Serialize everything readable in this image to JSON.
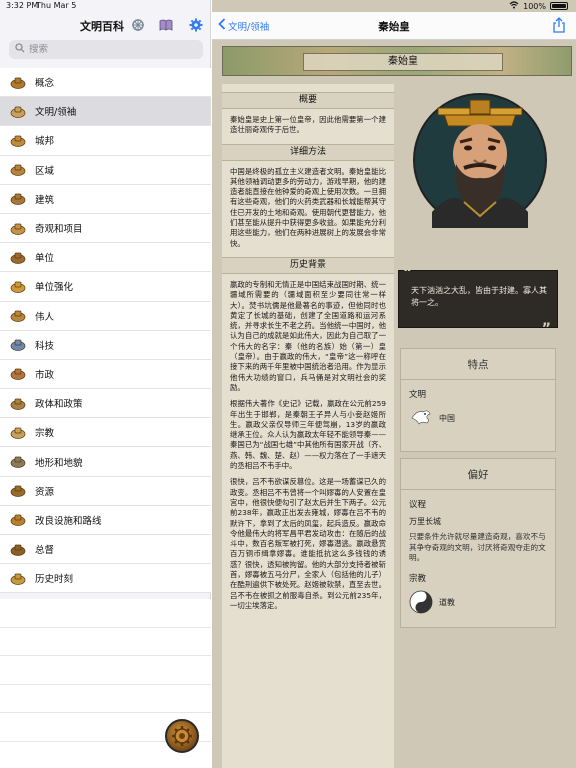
{
  "status": {
    "time": "3:32 PM",
    "date": "Thu Mar 5",
    "battery": "100%"
  },
  "sidebar": {
    "title": "文明百科",
    "search_placeholder": "搜索",
    "items": [
      {
        "label": "概念",
        "icon": "concepts-icon"
      },
      {
        "label": "文明/领袖",
        "icon": "leader-icon",
        "selected": true
      },
      {
        "label": "城邦",
        "icon": "city-state-icon"
      },
      {
        "label": "区域",
        "icon": "district-icon"
      },
      {
        "label": "建筑",
        "icon": "building-icon"
      },
      {
        "label": "奇观和项目",
        "icon": "wonder-icon"
      },
      {
        "label": "单位",
        "icon": "unit-icon"
      },
      {
        "label": "单位强化",
        "icon": "promotion-icon"
      },
      {
        "label": "伟人",
        "icon": "great-person-icon"
      },
      {
        "label": "科技",
        "icon": "tech-icon"
      },
      {
        "label": "市政",
        "icon": "civic-icon"
      },
      {
        "label": "政体和政策",
        "icon": "government-icon"
      },
      {
        "label": "宗教",
        "icon": "religion-icon"
      },
      {
        "label": "地形和地貌",
        "icon": "terrain-icon"
      },
      {
        "label": "资源",
        "icon": "resource-icon"
      },
      {
        "label": "改良设施和路线",
        "icon": "improvement-icon"
      },
      {
        "label": "总督",
        "icon": "governor-icon"
      },
      {
        "label": "历史时刻",
        "icon": "moments-icon"
      }
    ]
  },
  "nav": {
    "back_label": "文明/领袖",
    "title": "秦始皇"
  },
  "page": {
    "banner_title": "秦始皇",
    "sections": [
      {
        "heading": "概要",
        "paragraphs": [
          "秦始皇是史上第一位皇帝，因此他需要第一个建造壮丽奇观传于后世。"
        ]
      },
      {
        "heading": "详细方法",
        "paragraphs": [
          "中国是终极的孤立主义建造者文明。秦始皇能比其他领袖调动更多的劳动力，游戏早期，他的建造者能直接在他钟爱的奇观上使用次数。一旦拥有这些奇观，他们的火药类武器和长城能帮其守住已开发的土地和奇观。使用朝代更替能力，他们甚至能从提升中获得更多收益。如果能充分利用这些能力，他们在两种进展树上的发展会非常快。"
        ]
      },
      {
        "heading": "历史背景",
        "paragraphs": [
          "嬴政的专制和无情正是中国结束战国时期、统一疆域所需要的（疆域面积至少要同往常一样大）。焚书坑儒是他最著名的事迹，但他同时也黄定了长城的基础，创建了全国道路和运河系统，并寻求长生不老之药。当他统一中国时，他认为自己的成就是如此伟大，因此为自己取了一个伟大的名字：秦（他的名族）始（第一）皇（皇帝）。由于嬴政的伟大，“皇帝”这一称呼在接下来的两千年里被中国统治者沿用。作为显示他伟大功绩的窗口，兵马俑是对文明社会的奖励。",
          "根据伟大著作《史记》记载，嬴政在公元前259年出生于邯郸，是秦朝王子异人与小妾赵姬所生。嬴政父亲仅导师三年便驾崩，13岁的嬴政继承王位。众人认为嬴政太年轻不能领导秦——秦国已为“战国七雄”中其他所有国家开战（齐、燕、韩、魏、楚、赵）——权力落在了一手遮天的丞相吕不韦手中。",
          "很快，吕不韦欲谋反篡位。这是一场蓄谋已久的政变。丞相吕不韦曾将一个叫嫪毐的人安置在皇宫中，他很快便勾引了赵太后并生下两子。公元前238年，嬴政正出发去雍城，嫪毐在吕不韦的默许下，拿到了太后的凤玺，起兵造反。嬴政命令他最伟大的将军昌平君发动攻击：在随后的战斗中，数百名叛军被打死，嫪毐潜逃。嬴政悬赏百万铜币缉拿嫪毐。谁能抵抗这么多钱钱的诱惑？很快，透知被拘留。他的大部分支持者被斩首，嫪毐被五马分尸，全家人（包括他的儿子）在酷刑遍供下被处死。赵姬被软禁，直至去世。吕不韦在被抓之前服毒自杀。到公元前235年，一切尘埃落定。"
        ]
      }
    ],
    "quote": "天下汹汹之大乱，皆由于封建。寡人其将一之。",
    "traits": {
      "title": "特点",
      "civ_label": "文明",
      "civ_name": "中国"
    },
    "preferences": {
      "title": "偏好",
      "agenda_label": "议程",
      "agenda_name": "万里长城",
      "agenda_desc": "只要条件允许就尽量建造奇观，喜欢不与其争夺奇观的文明，讨厌将奇观夺走的文明。",
      "religion_label": "宗教",
      "religion_name": "道教"
    }
  }
}
